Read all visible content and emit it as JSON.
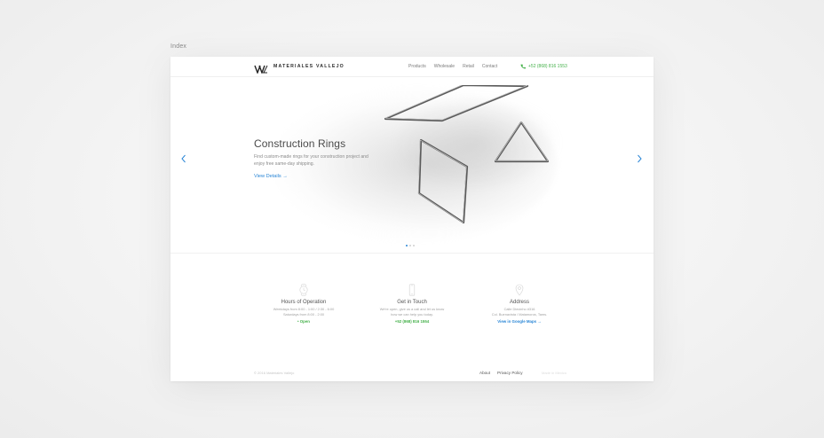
{
  "page": {
    "label": "Index"
  },
  "header": {
    "brand": "MATERIALES VALLEJO",
    "nav": [
      "Products",
      "Wholesale",
      "Retail",
      "Contact"
    ],
    "phone": "+52 (868) 816 1553"
  },
  "hero": {
    "title": "Construction Rings",
    "description": "Find custom-made rings for your construction project and enjoy free same-day shipping.",
    "cta": "View Details  →",
    "slides_total": 3,
    "active_slide": 1
  },
  "info": [
    {
      "icon": "clock-icon",
      "title": "Hours of Operation",
      "lines": [
        "Weekdays from 8:00 - 1:00 / 2:30 - 6:00",
        "Saturdays from 8:00 - 2:00"
      ],
      "link": "• Open",
      "link_color": "#44b04a"
    },
    {
      "icon": "phone-icon",
      "title": "Get in Touch",
      "lines": [
        "We're open, give us a call and let us know",
        "how we can help you today."
      ],
      "link": "+52 (868) 816 1554",
      "link_color": "#44b04a"
    },
    {
      "icon": "map-pin-icon",
      "title": "Address",
      "lines": [
        "Calle Diecinho #316",
        "Col. Buenavista / Matamoros, Tams."
      ],
      "link": "View in Google Maps →",
      "link_color": "#2a86d6"
    }
  ],
  "footer": {
    "copyright": "© 2016 Materiales Vallejo",
    "links": [
      "About",
      "Privacy Policy"
    ],
    "credit": "Made in Mexico"
  },
  "colors": {
    "accent": "#2a86d6",
    "green": "#44b04a",
    "text": "#4a4a4a"
  }
}
